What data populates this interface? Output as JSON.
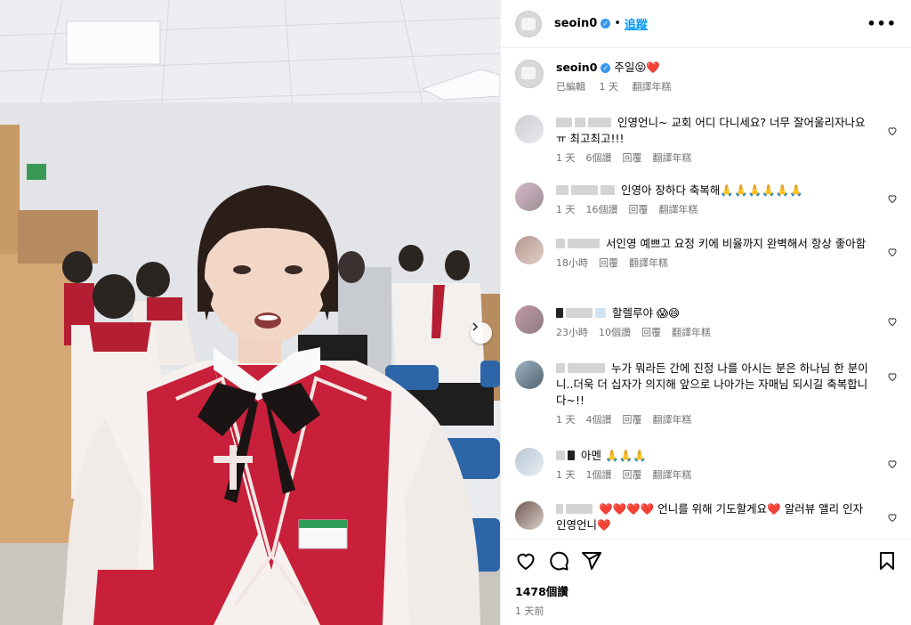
{
  "header": {
    "username": "seoin0",
    "separator": "•",
    "follow_label": "追蹤",
    "more_label": "•••"
  },
  "caption": {
    "username": "seoin0",
    "text": "주일😝❤️",
    "meta": [
      "已編輯",
      "1 天",
      "翻譯年糕"
    ]
  },
  "comments": [
    {
      "text": "인영언니~ 교회 어디 다니세요? 너무 잘어울리자나요ㅠ 최고최고!!!",
      "time": "1 天",
      "likes": "6個讚",
      "reply": "回覆",
      "translate": "翻譯年糕"
    },
    {
      "text": "인영아 장하다 축복해🙏🙏🙏🙏🙏🙏",
      "time": "1 天",
      "likes": "16個讚",
      "reply": "回覆",
      "translate": "翻譯年糕"
    },
    {
      "text": "서인영 예쁘고 요정 키에 비율까지 완벽해서 항상 좋아함",
      "time": "18小時",
      "likes": "",
      "reply": "回覆",
      "translate": "翻譯年糕"
    },
    {
      "text": "할렐루야 😱😄",
      "time": "23小時",
      "likes": "10個讚",
      "reply": "回覆",
      "translate": "翻譯年糕"
    },
    {
      "text": "누가 뭐라든 간에 진정 나를 아시는 분은 하나님 한 분이니..더욱 더 십자가 의지해 앞으로 나아가는 자매님 되시길 축복합니다~!!",
      "time": "1 天",
      "likes": "4個讚",
      "reply": "回覆",
      "translate": "翻譯年糕"
    },
    {
      "text": "아멘 🙏🙏🙏",
      "time": "1 天",
      "likes": "1個讚",
      "reply": "回覆",
      "translate": "翻譯年糕"
    },
    {
      "text": "❤️❤️❤️❤️ 언니를 위해 기도할게요❤️ 알러뷰 앨리 인자 인영언니❤️",
      "time": "",
      "likes": "",
      "reply": "",
      "translate": ""
    }
  ],
  "footer": {
    "likes": "1478個讚",
    "time": "1 天前"
  },
  "colors": {
    "link": "#0095f6",
    "meta": "#737373",
    "robe_red": "#c8203a"
  },
  "icons": [
    "heart-icon",
    "comment-icon",
    "share-icon",
    "bookmark-icon",
    "chevron-right-icon",
    "more-icon"
  ]
}
